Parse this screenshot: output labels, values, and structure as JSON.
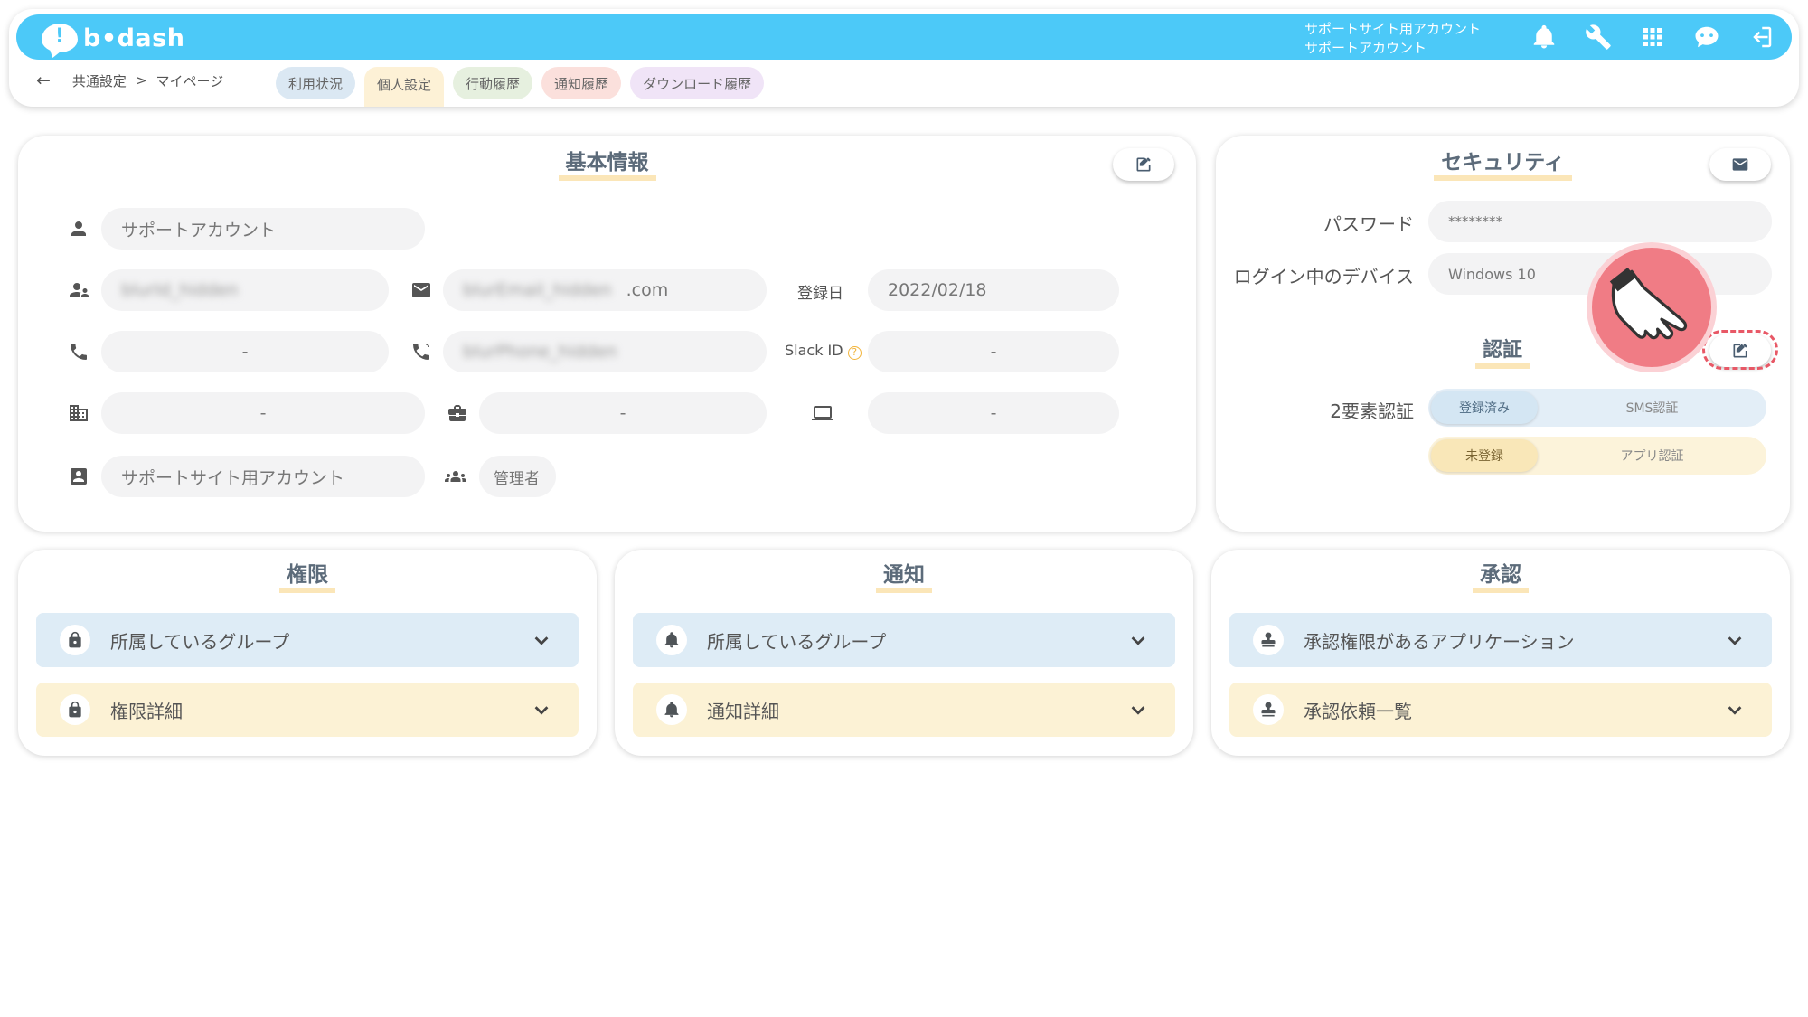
{
  "app": {
    "logo_mark": "!",
    "logo_text": "b•dash",
    "account_line1": "サポートサイト用アカウント",
    "account_line2": "サポートアカウント",
    "top_icons": [
      "bell-icon",
      "wrench-icon",
      "grid-icon",
      "chat-bot-icon",
      "logout-icon"
    ]
  },
  "breadcrumb": {
    "back": "←",
    "parent": "共通設定",
    "separator": ">",
    "current": "マイページ"
  },
  "tabs": [
    {
      "label": "利用状況",
      "color": "#dbe8f3"
    },
    {
      "label": "個人設定",
      "color": "#fdf1d6",
      "active": true
    },
    {
      "label": "行動履歴",
      "color": "#e6f0df"
    },
    {
      "label": "通知履歴",
      "color": "#fbe0dc"
    },
    {
      "label": "ダウンロード履歴",
      "color": "#f0e4f7"
    }
  ],
  "basic": {
    "title": "基本情報",
    "name": "サポートアカウント",
    "user_id": "blurId_hidden",
    "email_prefix": "blurEmail_hidden",
    "email_suffix": ".com",
    "registered_label": "登録日",
    "registered_value": "2022/02/18",
    "phone": "-",
    "mobile": "blurPhone_hidden",
    "slack_label": "Slack ID",
    "slack_value": "-",
    "building": "-",
    "department": "-",
    "device": "-",
    "account_type": "サポートサイト用アカウント",
    "role": "管理者"
  },
  "security": {
    "title": "セキュリティ",
    "password_label": "パスワード",
    "password_value": "********",
    "device_label": "ログイン中のデバイス",
    "device_value": "Windows 10",
    "auth_title": "認証",
    "two_factor_label": "2要素認証",
    "sms_status": "登録済み",
    "sms_label": "SMS認証",
    "app_status": "未登録",
    "app_label": "アプリ認証"
  },
  "permissions": {
    "title": "権限",
    "item1": "所属しているグループ",
    "item2": "権限詳細"
  },
  "notifications": {
    "title": "通知",
    "item1": "所属しているグループ",
    "item2": "通知詳細"
  },
  "approvals": {
    "title": "承認",
    "item1": "承認権限があるアプリケーション",
    "item2": "承認依頼一覧"
  },
  "colors": {
    "topbar": "#4cc9f8",
    "blue_row": "#deecf6",
    "yellow_row": "#fcf2d5",
    "title_underline": "#fbe6b8",
    "highlight": "#f07c85"
  }
}
